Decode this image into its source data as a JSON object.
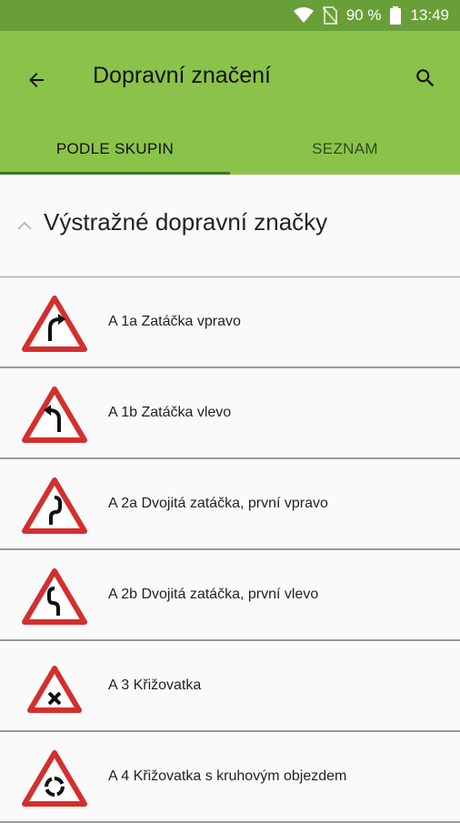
{
  "status": {
    "battery": "90 %",
    "time": "13:49"
  },
  "toolbar": {
    "title": "Dopravní značení"
  },
  "tabs": [
    {
      "label": "PODLE SKUPIN"
    },
    {
      "label": "SEZNAM"
    }
  ],
  "group": {
    "title": "Výstražné dopravní značky"
  },
  "signs": [
    {
      "label": "A 1a Zatáčka vpravo",
      "icon": "curve-right-sign-icon"
    },
    {
      "label": "A 1b Zatáčka vlevo",
      "icon": "curve-left-sign-icon"
    },
    {
      "label": "A 2a Dvojitá zatáčka, první vpravo",
      "icon": "double-curve-right-sign-icon"
    },
    {
      "label": "A 2b Dvojitá zatáčka, první vlevo",
      "icon": "double-curve-left-sign-icon"
    },
    {
      "label": "A 3 Křižovatka",
      "icon": "crossroads-sign-icon"
    },
    {
      "label": "A 4 Křižovatka s kruhovým objezdem",
      "icon": "roundabout-sign-icon"
    }
  ],
  "colors": {
    "appbar": "#8bc34a",
    "statusbar": "#689f38",
    "sign_red": "#d32f2f"
  }
}
